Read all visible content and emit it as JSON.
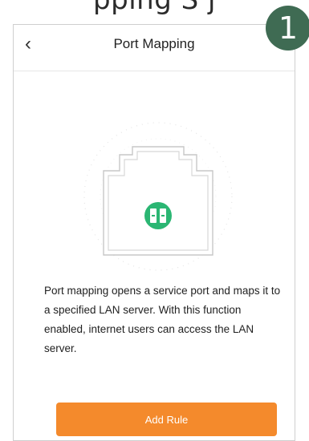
{
  "page_heading_partial": "pping  S  j",
  "step_badge": "1",
  "header": {
    "back_icon": "chevron-left-icon",
    "title": "Port Mapping"
  },
  "illustration": {
    "icon": "port-mapping-icon",
    "accent_color": "#2bb673"
  },
  "description": "Port mapping opens a service port and maps it to a specified LAN server. With this function enabled, internet users can access the LAN server.",
  "actions": {
    "add_rule_label": "Add Rule",
    "button_color": "#f48a2c"
  }
}
